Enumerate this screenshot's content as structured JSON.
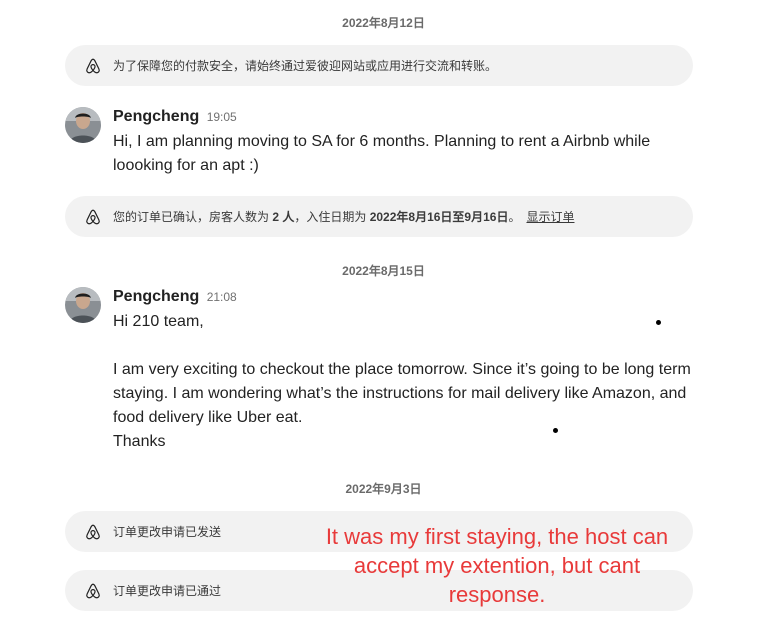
{
  "dates": {
    "d1": "2022年8月12日",
    "d2": "2022年8月15日",
    "d3": "2022年9月3日"
  },
  "system_messages": {
    "payment_warning": "为了保障您的付款安全，请始终通过爱彼迎网站或应用进行交流和转账。",
    "booking_confirmed": {
      "prefix": "您的订单已确认，房客人数为 ",
      "guests": "2 人",
      "mid": "，入住日期为 ",
      "dates": "2022年8月16日至9月16日",
      "suffix": "。",
      "link": "显示订单"
    },
    "change_sent": "订单更改申请已发送",
    "change_approved": "订单更改申请已通过"
  },
  "messages": [
    {
      "sender": "Pengcheng",
      "time": "19:05",
      "lines": [
        "Hi, I am planning moving to SA for 6 months. Planning to rent a Airbnb while loooking for an apt :)"
      ]
    },
    {
      "sender": "Pengcheng",
      "time": "21:08",
      "lines": [
        "Hi 210 team,",
        "",
        "I am very exciting to checkout the place tomorrow. Since it’s going to be long term staying. I am wondering what’s the instructions for mail delivery like Amazon, and food delivery like Uber eat.",
        "Thanks"
      ]
    }
  ],
  "annotation": "It was my first staying, the host can accept my extention, but cant response.",
  "colors": {
    "annotation": "#e83a3a",
    "system_bg": "#f2f2f2",
    "date_text": "#6a6a6a"
  },
  "icons": {
    "system_logo": "airbnb-logo-icon",
    "avatar": "user-avatar"
  }
}
